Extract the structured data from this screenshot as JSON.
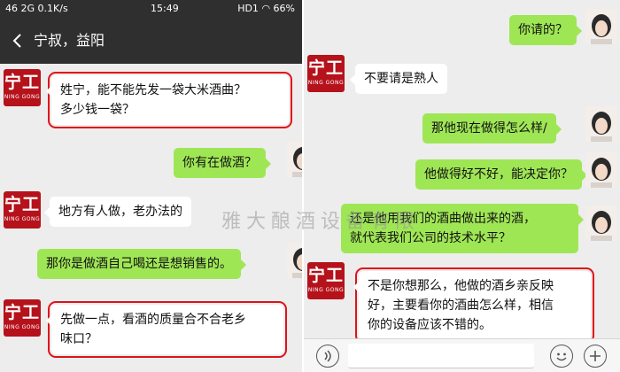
{
  "colors": {
    "header_bg": "#2f2f2f",
    "chat_bg": "#ededed",
    "incoming_bubble": "#ffffff",
    "outgoing_bubble": "#9fe655",
    "highlight_box": "#e0121a",
    "logo_red": "#b5121b"
  },
  "status_bar": {
    "carrier": "46 2G",
    "speed": "0.1K/s",
    "time": "15:49",
    "network": "HD1",
    "battery": "66%"
  },
  "header": {
    "title": "宁叔，益阳"
  },
  "logo": {
    "main": "宁工",
    "sub": "NING GONG"
  },
  "left_messages": [
    {
      "sender": "contact",
      "line1": "姓宁，能不能先发一袋大米酒曲？",
      "line2": "多少钱一袋？",
      "highlighted": true
    },
    {
      "sender": "me",
      "line1": "你有在做酒？"
    },
    {
      "sender": "contact",
      "line1": "地方有人做，老办法的"
    },
    {
      "sender": "me",
      "line1": "那你是做酒自己喝还是想销售的。"
    },
    {
      "sender": "contact",
      "line1": "先做一点，看酒的质量合不合老乡",
      "line2": "味口？",
      "highlighted": true
    }
  ],
  "right_messages": [
    {
      "sender": "me",
      "line1": "你请的？"
    },
    {
      "sender": "contact",
      "line1": "不要请是熟人"
    },
    {
      "sender": "me",
      "line1": "那他现在做得怎么样/"
    },
    {
      "sender": "me",
      "line1": "他做得好不好，能决定你？"
    },
    {
      "sender": "me",
      "line1": "还是他用我们的酒曲做出来的酒，",
      "line2": "就代表我们公司的技术水平？"
    },
    {
      "sender": "contact",
      "line1": "不是你想那么，他做的酒乡亲反映",
      "line2": "好，主要看你的酒曲怎么样，相信",
      "line3": "你的设备应该不错的。",
      "highlighted": true
    }
  ],
  "watermark": "雅大酿酒设备有限",
  "icons": {
    "back": "back-arrow-icon",
    "voice": "voice-icon",
    "emoji": "emoji-icon",
    "plus": "plus-icon"
  }
}
